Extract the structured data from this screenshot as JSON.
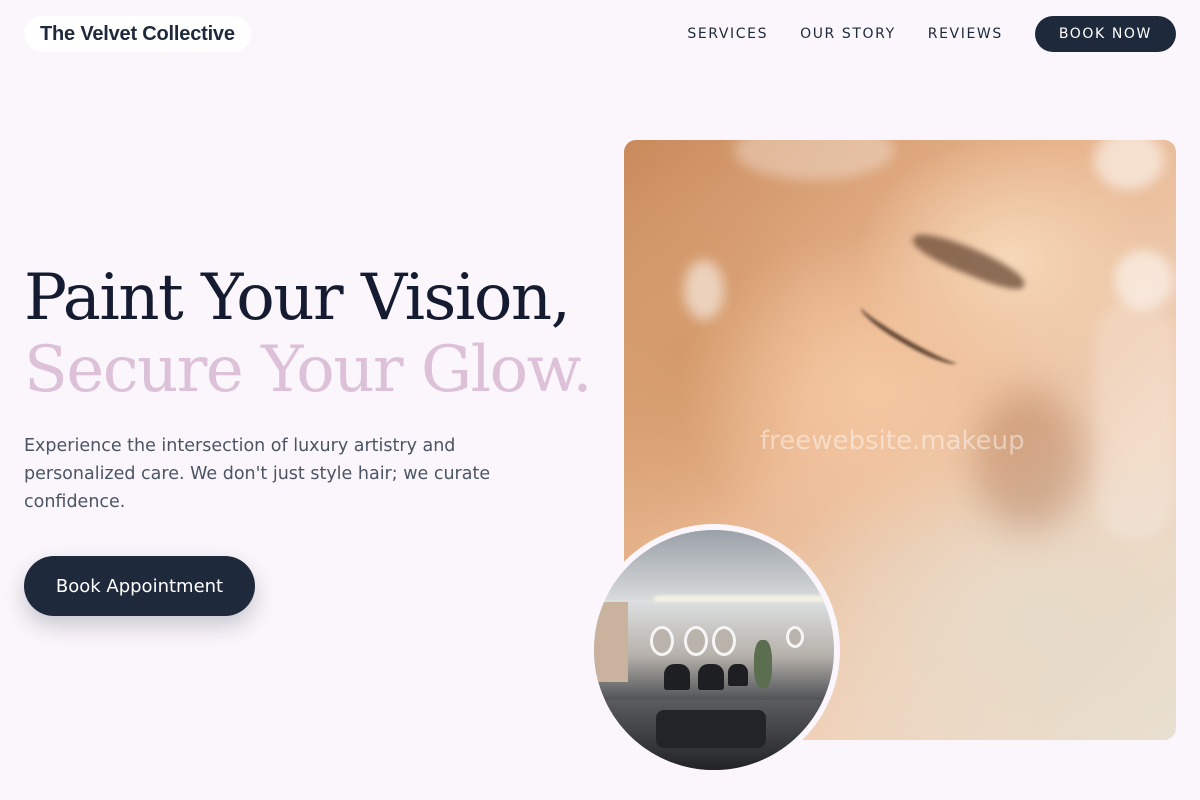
{
  "brand": {
    "name": "The Velvet Collective"
  },
  "nav": {
    "links": [
      "SERVICES",
      "OUR STORY",
      "REVIEWS"
    ],
    "cta": "BOOK NOW"
  },
  "hero": {
    "title_line1": "Paint Your Vision,",
    "title_line2": "Secure Your Glow.",
    "description": "Experience the intersection of luxury artistry and personalized care. We don't just style hair; we curate confidence.",
    "cta": "Book Appointment"
  },
  "images": {
    "main_watermark": "freewebsite.makeup",
    "main_icon": "portrait-photo",
    "secondary_icon": "salon-interior-photo"
  },
  "colors": {
    "background": "#faf6fb",
    "primary": "#1e293b",
    "accent": "#dcc1d8",
    "body_text": "#4b5563"
  }
}
